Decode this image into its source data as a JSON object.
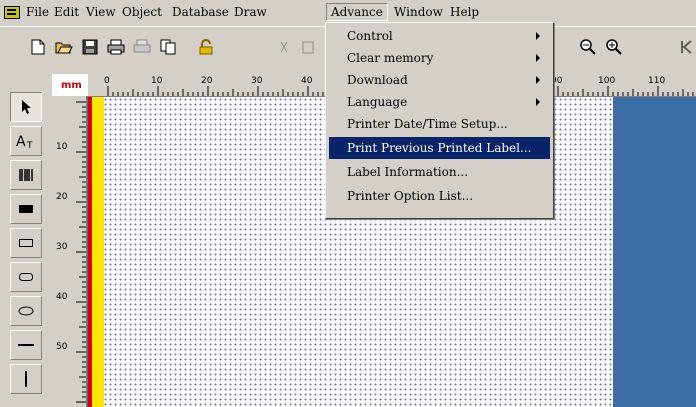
{
  "menubar": {
    "items": [
      "File",
      "Edit",
      "View",
      "Object",
      "Database",
      "Draw",
      "Advance",
      "Window",
      "Help"
    ],
    "open_item": "Advance"
  },
  "advance_menu": {
    "items": [
      {
        "label": "Control",
        "submenu": true
      },
      {
        "label": "Clear memory",
        "submenu": true
      },
      {
        "label": "Download",
        "submenu": true
      },
      {
        "label": "Language",
        "submenu": true
      },
      {
        "label": "Printer Date/Time Setup...",
        "submenu": false
      },
      {
        "label": "Print Previous Printed Label...",
        "submenu": false,
        "highlighted": true
      },
      {
        "label": "Label Information...",
        "submenu": false
      },
      {
        "label": "Printer Option List...",
        "submenu": false
      }
    ]
  },
  "ruler": {
    "unit": "mm",
    "h_labels": [
      "0",
      "10",
      "20",
      "30",
      "40",
      "90",
      "100",
      "110"
    ],
    "v_labels": [
      "10",
      "20",
      "30",
      "40",
      "50"
    ]
  },
  "tools": [
    "pointer",
    "text",
    "barcode",
    "filled-rectangle",
    "rectangle",
    "rounded-rectangle",
    "ellipse",
    "horizontal-line",
    "vertical-line"
  ],
  "colors": {
    "menu_highlight": "#0a246a",
    "workspace": "#3c6ea5",
    "grid_dot": "#6a6adc",
    "label_edge_red": "#e00000",
    "label_edge_yellow": "#ffe800"
  }
}
